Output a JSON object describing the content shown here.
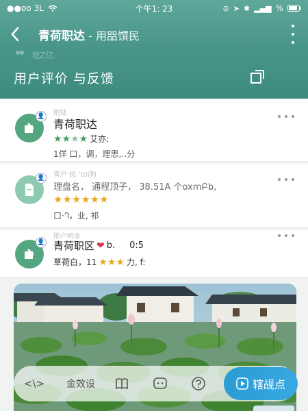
{
  "status_bar": {
    "left_text": "●●oo 3L",
    "time": "个午1: 23",
    "battery_text": "%"
  },
  "nav": {
    "title": "青荷职达",
    "subtitle": " - 用㗊馔民",
    "ghost_text": "㘺Z亿"
  },
  "page": {
    "title": "用户评价 与反馈"
  },
  "reviews": [
    {
      "faint_name": "附陆",
      "name": "青荷职达",
      "rating_line_text": "艾亦:",
      "meta": "1佯 口，调，理思,‥分",
      "icon": "edit-doc-icon"
    },
    {
      "faint_name": "青户‘扰 ’t0l狗",
      "name": "理盘名， 通程顶子，  38.51A 个oxmԲb,",
      "meta": "口·ᘃ，业, 祁",
      "icon": "document-icon"
    },
    {
      "faint_name": "邢户哟本",
      "name_prefix": "青荷职区",
      "name_suffix": "b.",
      "name_time": "0:5",
      "rating_prefix": "草荷白，11",
      "rating_suffix": "力, f:",
      "icon": "edit-doc-icon"
    }
  ],
  "toolbar": {
    "code_label": "<\\>",
    "comment_placeholder": "金效设",
    "primary_label": "辖觇点"
  },
  "colors": {
    "header": "#4a978a",
    "avatar": "#53a680",
    "primary": "#2a9bd4",
    "star_green": "#3b9e5a",
    "star_gold": "#e8a820"
  }
}
